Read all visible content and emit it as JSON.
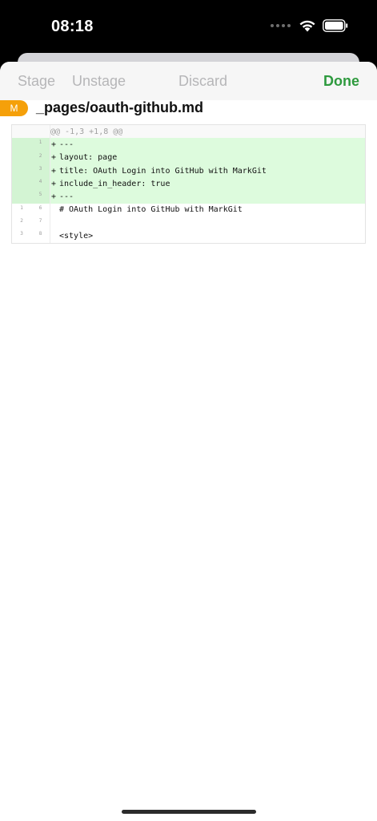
{
  "status_bar": {
    "time": "08:18"
  },
  "toolbar": {
    "stage_label": "Stage",
    "unstage_label": "Unstage",
    "discard_label": "Discard",
    "done_label": "Done",
    "accent_color": "#2e9a3e",
    "disabled_color": "#b6b6b8"
  },
  "file": {
    "status": "M",
    "status_color": "#f5a00a",
    "name": "_pages/oauth-github.md"
  },
  "diff": {
    "hunk_header": "@@ -1,3 +1,8 @@",
    "added_color": "#ddfbdd",
    "lines": [
      {
        "type": "added",
        "old": "",
        "new": "1",
        "marker": "+",
        "text": "---"
      },
      {
        "type": "added",
        "old": "",
        "new": "2",
        "marker": "+",
        "text": "layout: page"
      },
      {
        "type": "added",
        "old": "",
        "new": "3",
        "marker": "+",
        "text": "title: OAuth Login into GitHub with MarkGit"
      },
      {
        "type": "added",
        "old": "",
        "new": "4",
        "marker": "+",
        "text": "include_in_header: true"
      },
      {
        "type": "added",
        "old": "",
        "new": "5",
        "marker": "+",
        "text": "---"
      },
      {
        "type": "context",
        "old": "1",
        "new": "6",
        "marker": "",
        "text": "# OAuth Login into GitHub with MarkGit"
      },
      {
        "type": "context",
        "old": "2",
        "new": "7",
        "marker": "",
        "text": ""
      },
      {
        "type": "context",
        "old": "3",
        "new": "8",
        "marker": "",
        "text": "<style>"
      }
    ]
  }
}
